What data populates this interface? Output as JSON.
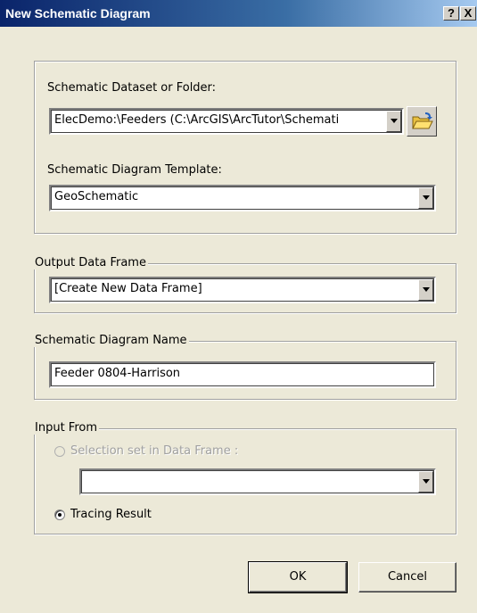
{
  "window": {
    "title": "New Schematic Diagram",
    "help_label": "?",
    "close_label": "X"
  },
  "dataset_group": {
    "dataset_label": "Schematic Dataset or Folder:",
    "dataset_value": "ElecDemo:\\Feeders (C:\\ArcGIS\\ArcTutor\\Schemati",
    "template_label": "Schematic Diagram Template:",
    "template_value": "GeoSchematic"
  },
  "output_frame": {
    "legend": "Output Data Frame",
    "value": "[Create New Data Frame]"
  },
  "diagram_name": {
    "legend": "Schematic Diagram Name",
    "value": "Feeder 0804-Harrison"
  },
  "input_from": {
    "legend": "Input From",
    "option_selection": "Selection set in Data Frame :",
    "selection_value": "",
    "option_tracing": "Tracing Result",
    "selected": "tracing"
  },
  "buttons": {
    "ok": "OK",
    "cancel": "Cancel"
  },
  "colors": {
    "title_bar": "#0a246a",
    "dialog_bg": "#ece9d8"
  }
}
